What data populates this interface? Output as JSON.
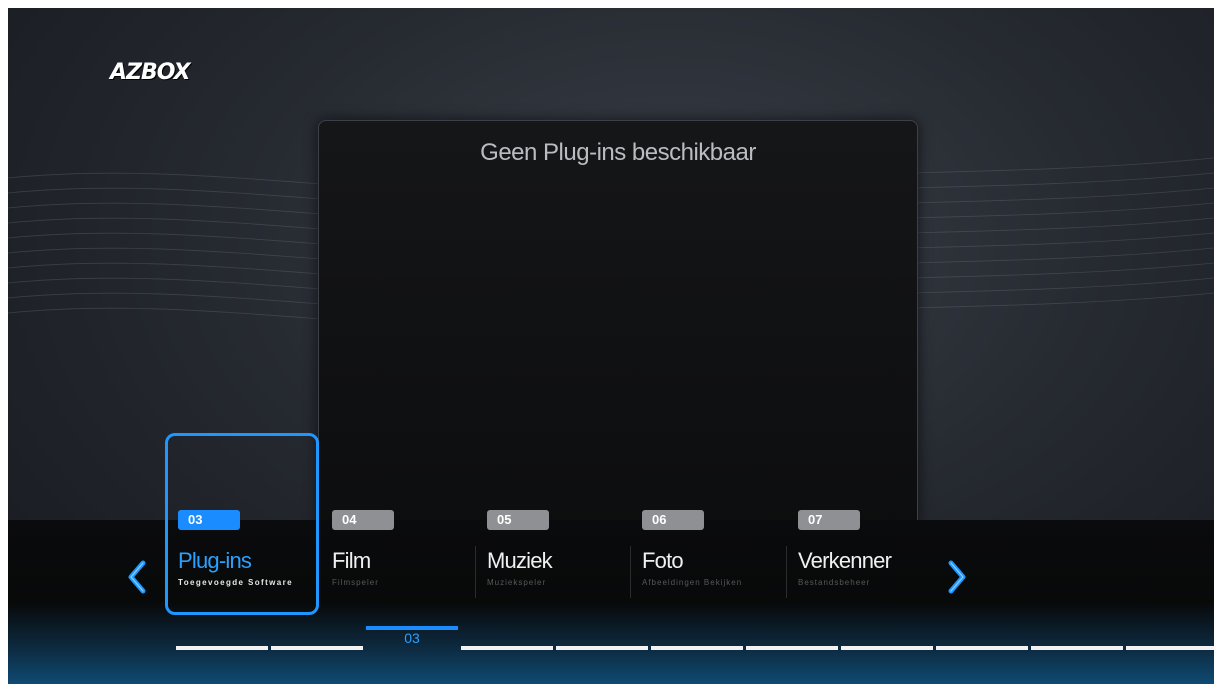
{
  "brand": {
    "logo_text": "AZBOX"
  },
  "panel": {
    "message": "Geen Plug-ins beschikbaar"
  },
  "menu": {
    "items": [
      {
        "number": "03",
        "title": "Plug-ins",
        "subtitle": "Toegevoegde Software",
        "selected": true
      },
      {
        "number": "04",
        "title": "Film",
        "subtitle": "Filmspeler",
        "selected": false
      },
      {
        "number": "05",
        "title": "Muziek",
        "subtitle": "Muziekspeler",
        "selected": false
      },
      {
        "number": "06",
        "title": "Foto",
        "subtitle": "Afbeeldingen Bekijken",
        "selected": false
      },
      {
        "number": "07",
        "title": "Verkenner",
        "subtitle": "Bestandsbeheer",
        "selected": false
      }
    ],
    "left_arrow_icon": "chevron-left-icon",
    "right_arrow_icon": "chevron-right-icon"
  },
  "pager": {
    "current_label": "03",
    "segment_count": 11,
    "current_index": 2
  },
  "colors": {
    "accent": "#1a8cff",
    "inactive_badge": "#8e9093"
  }
}
